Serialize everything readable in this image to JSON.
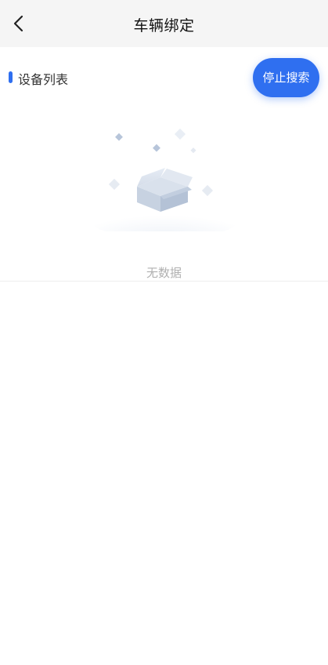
{
  "header": {
    "title": "车辆绑定",
    "back_icon": "chevron-left-icon"
  },
  "device_list": {
    "title": "设备列表",
    "accent_color": "#2f6ff0",
    "stop_search_label": "停止搜索",
    "empty_text": "无数据"
  }
}
